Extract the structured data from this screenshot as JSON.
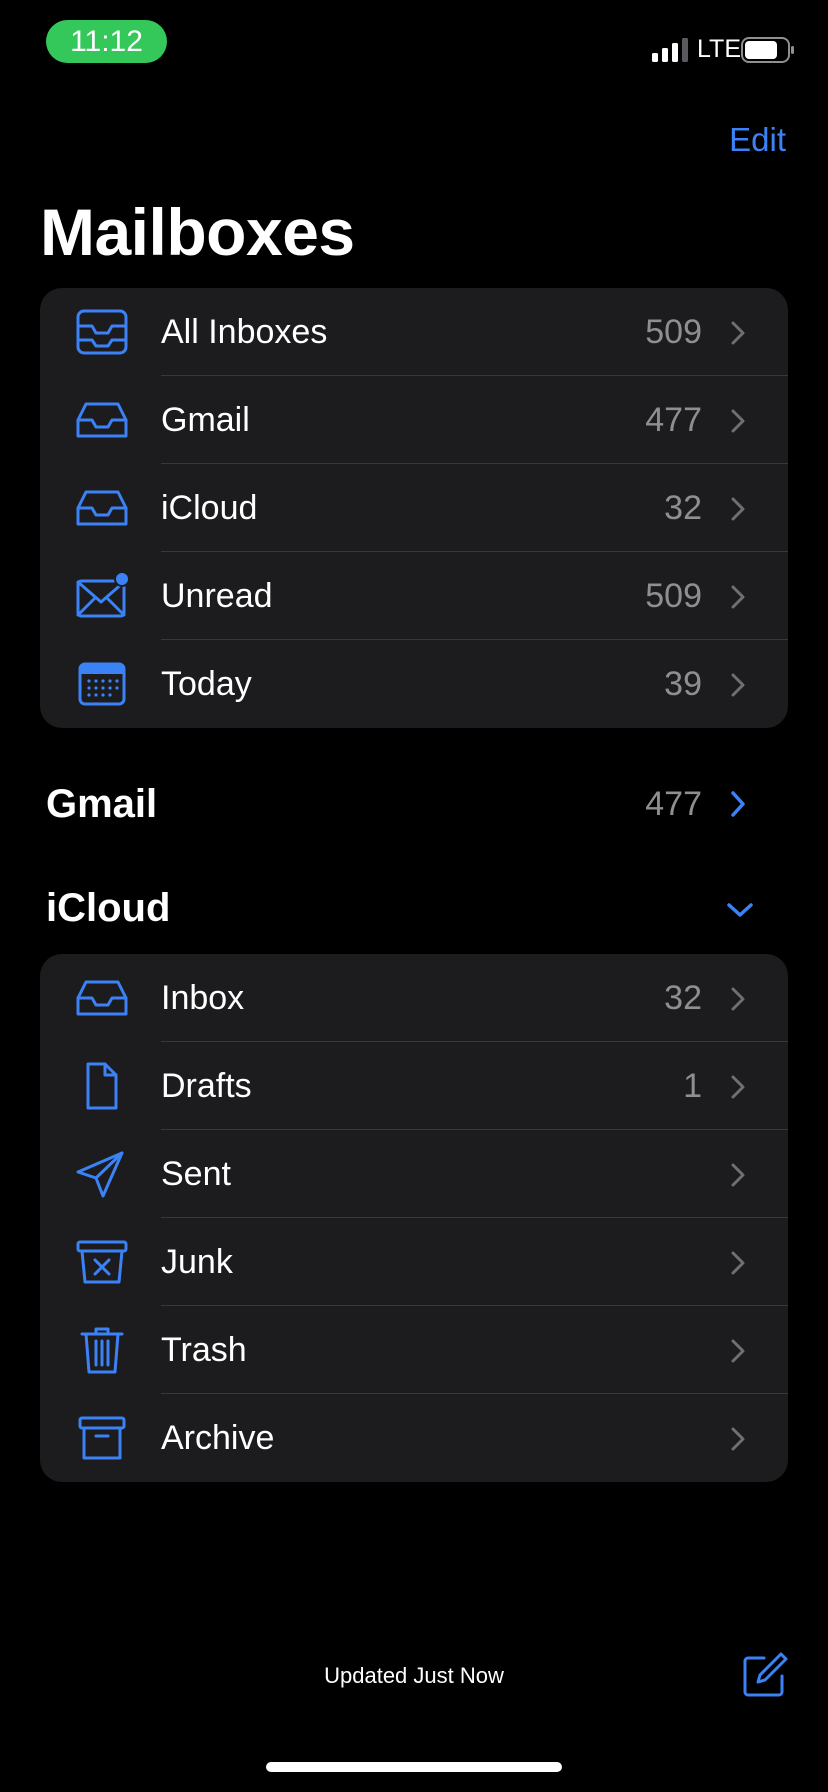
{
  "status_bar": {
    "time": "11:12",
    "network": "LTE"
  },
  "nav": {
    "edit_label": "Edit",
    "title": "Mailboxes"
  },
  "mailboxes": [
    {
      "label": "All Inboxes",
      "count": "509",
      "icon": "all-inboxes-icon"
    },
    {
      "label": "Gmail",
      "count": "477",
      "icon": "inbox-tray-icon"
    },
    {
      "label": "iCloud",
      "count": "32",
      "icon": "inbox-tray-icon"
    },
    {
      "label": "Unread",
      "count": "509",
      "icon": "unread-envelope-icon"
    },
    {
      "label": "Today",
      "count": "39",
      "icon": "calendar-icon"
    }
  ],
  "gmail_section": {
    "title": "Gmail",
    "count": "477"
  },
  "icloud_section": {
    "title": "iCloud"
  },
  "icloud_folders": [
    {
      "label": "Inbox",
      "count": "32",
      "icon": "inbox-tray-icon"
    },
    {
      "label": "Drafts",
      "count": "1",
      "icon": "document-icon"
    },
    {
      "label": "Sent",
      "count": "",
      "icon": "paper-plane-icon"
    },
    {
      "label": "Junk",
      "count": "",
      "icon": "junk-bin-icon"
    },
    {
      "label": "Trash",
      "count": "",
      "icon": "trash-icon"
    },
    {
      "label": "Archive",
      "count": "",
      "icon": "archive-box-icon"
    }
  ],
  "footer": {
    "status": "Updated Just Now"
  },
  "colors": {
    "accent": "#3b82f6",
    "background": "#000000",
    "card": "#1c1c1e",
    "secondary_text": "#8e8e93",
    "time_pill": "#34c759"
  }
}
